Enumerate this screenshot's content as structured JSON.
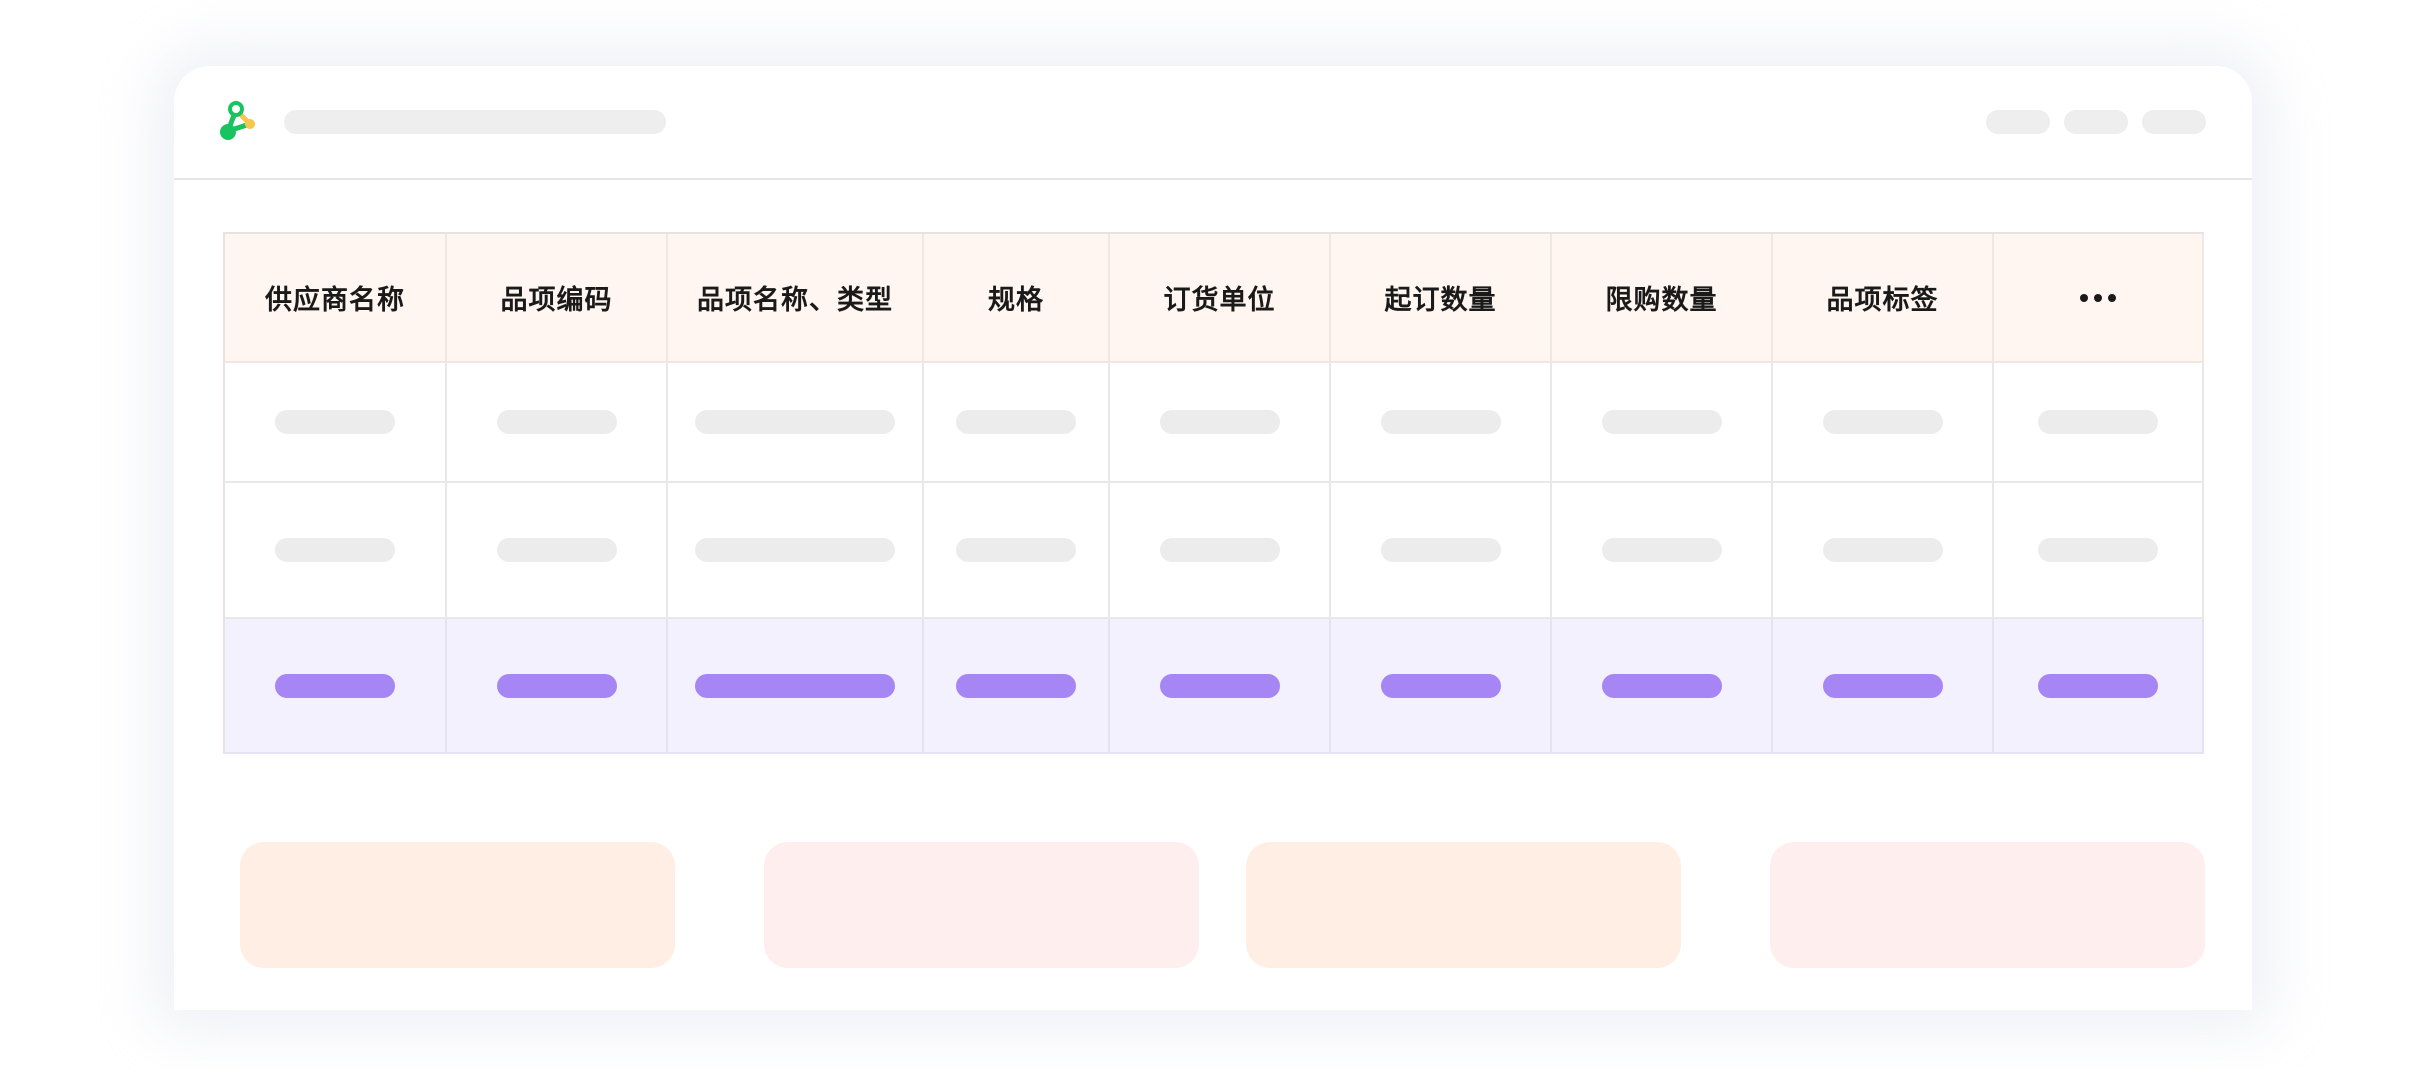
{
  "app": {
    "logo_icon": "tri-node-logo-icon",
    "colors": {
      "logo_green": "#19c35f",
      "logo_yellow": "#f7c64a",
      "header_bg": "#fff6f1",
      "selected_row_bg": "#f4f1fe",
      "accent": "#a685f5"
    }
  },
  "table": {
    "headers": [
      "供应商名称",
      "品项编码",
      "品项名称、类型",
      "规格",
      "订货单位",
      "起订数量",
      "限购数量",
      "品项标签"
    ],
    "more_icon": "more-horizontal-icon"
  }
}
